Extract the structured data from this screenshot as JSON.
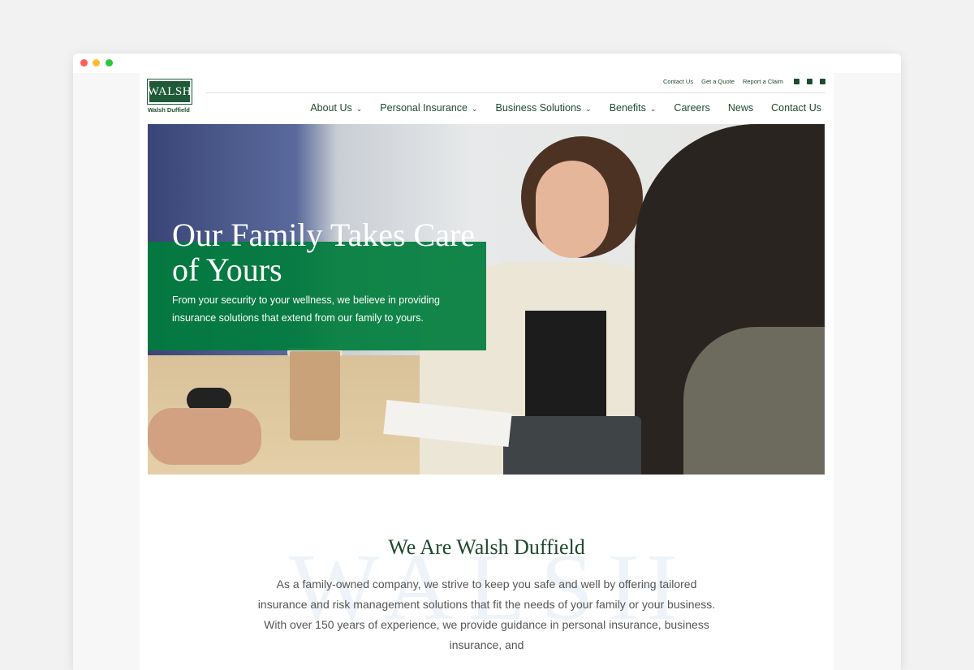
{
  "brand": {
    "logo_text": "WALSH",
    "logo_subtitle": "Walsh Duffield",
    "primary_color": "#1e4a2e",
    "accent_green": "#007d3c"
  },
  "utility_nav": {
    "links": [
      "Contact Us",
      "Get a Quote",
      "Report a Claim"
    ],
    "social_icons": [
      "facebook-icon",
      "linkedin-icon",
      "twitter-icon"
    ]
  },
  "main_nav": {
    "items": [
      {
        "label": "About Us",
        "has_dropdown": true
      },
      {
        "label": "Personal Insurance",
        "has_dropdown": true
      },
      {
        "label": "Business Solutions",
        "has_dropdown": true
      },
      {
        "label": "Benefits",
        "has_dropdown": true
      },
      {
        "label": "Careers",
        "has_dropdown": false
      },
      {
        "label": "News",
        "has_dropdown": false
      },
      {
        "label": "Contact Us",
        "has_dropdown": false
      }
    ],
    "dropdown_glyph": "⌄"
  },
  "hero": {
    "title": "Our Family Takes Care of Yours",
    "subtitle": "From your security to your wellness, we believe in providing insurance solutions that extend from our family to yours."
  },
  "about": {
    "watermark": "WALSH",
    "title": "We Are Walsh Duffield",
    "body": "As a family-owned company, we strive to keep you safe and well by offering tailored insurance and risk management solutions that fit the needs of your family or your business. With over 150 years of experience, we provide guidance in personal insurance, business insurance, and"
  }
}
